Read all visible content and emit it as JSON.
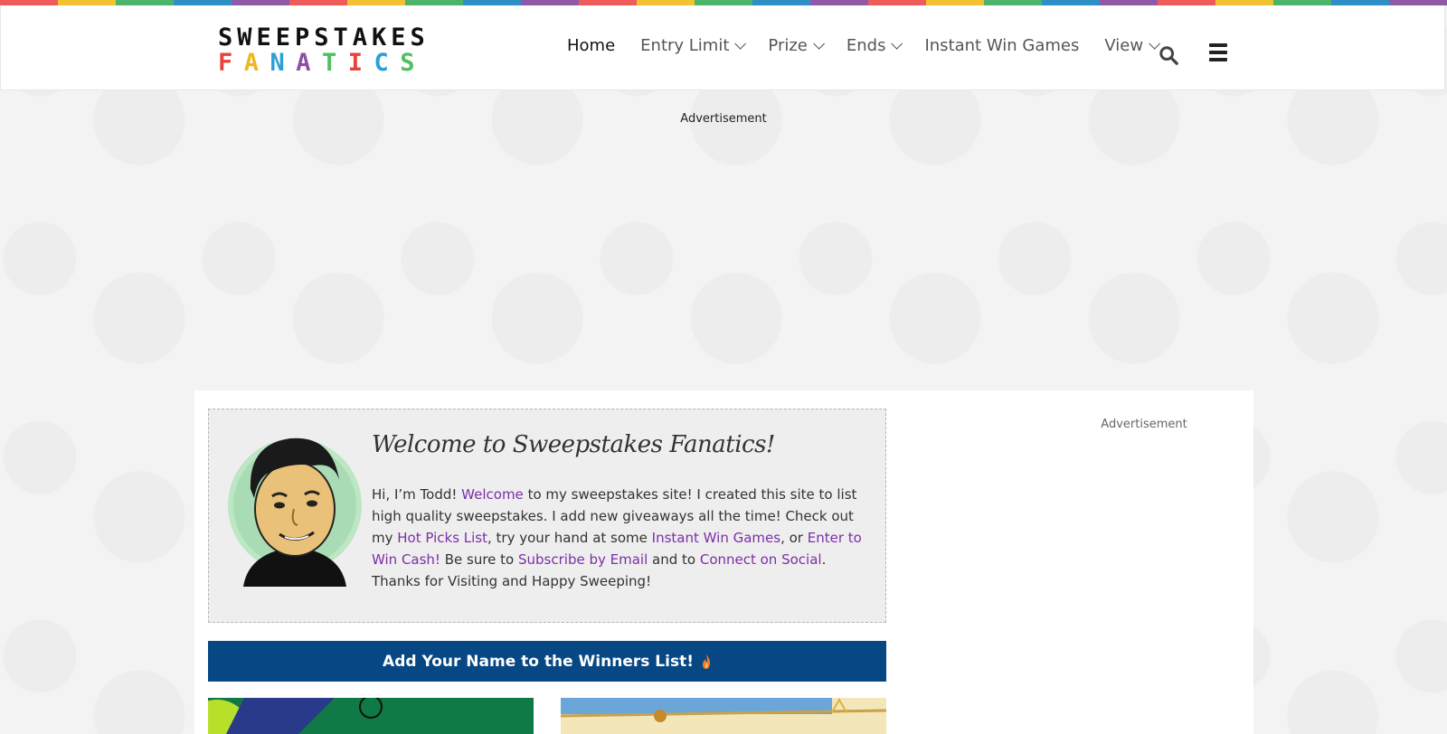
{
  "brand": {
    "line1": "SWEEPSTAKES",
    "line2_letters": [
      "F",
      "A",
      "N",
      "A",
      "T",
      "I",
      "C",
      "S"
    ],
    "line2_colors": [
      "#e8433a",
      "#f1b61c",
      "#2b9fd6",
      "#8e4fa6",
      "#4fbf5f",
      "#e8433a",
      "#2b9fd6",
      "#4fbf5f"
    ],
    "stripe_colors": [
      "#ef5b5b",
      "#f1c232",
      "#4db36b",
      "#2e8fc4",
      "#8e5aa8"
    ]
  },
  "nav": {
    "home": "Home",
    "entry_limit": "Entry Limit",
    "prize": "Prize",
    "ends": "Ends",
    "instant_win": "Instant Win Games",
    "view": "View"
  },
  "ads": {
    "top": "Advertisement",
    "side": "Advertisement"
  },
  "welcome": {
    "title": "Welcome to Sweepstakes Fanatics!",
    "t1": "Hi, I’m Todd! ",
    "l1": "Welcome",
    "t2": " to my sweepstakes site! I created this site to list high quality sweepstakes. I add new giveaways all the time! Check out my ",
    "l2": "Hot Picks List",
    "t3": ", try your hand at some ",
    "l3": "Instant Win Games",
    "t4": ", or ",
    "l4": "Enter to Win Cash!",
    "t5": " Be sure to ",
    "l5": "Subscribe by Email",
    "t6": " and to ",
    "l6": "Connect on Social",
    "t7": ". Thanks for Visiting and Happy Sweeping!"
  },
  "winners_button": "Add Your Name to the Winners List!",
  "colors": {
    "link": "#7b2fa6",
    "button_bg": "#074783"
  }
}
